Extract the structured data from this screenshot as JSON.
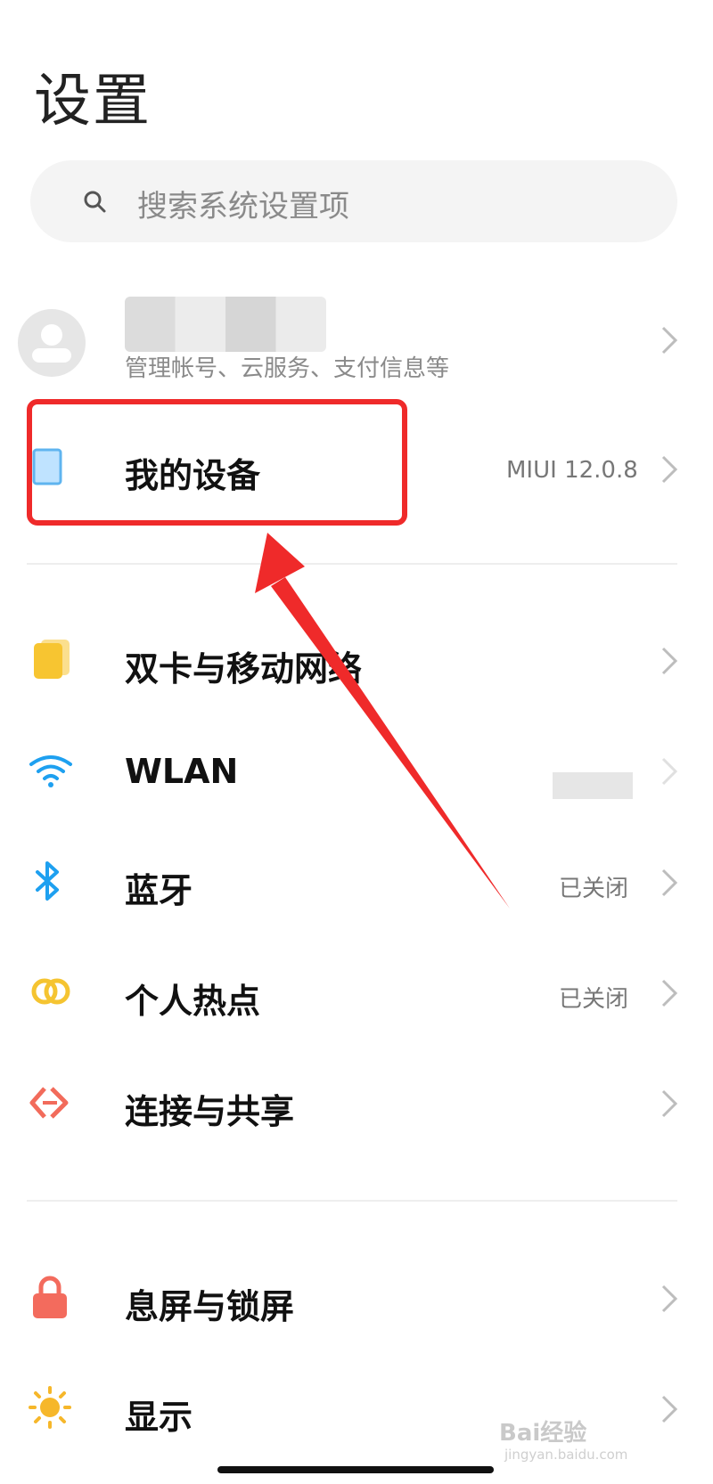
{
  "header": {
    "title": "设置"
  },
  "search": {
    "placeholder": "搜索系统设置项"
  },
  "account": {
    "subtitle": "管理帐号、云服务、支付信息等"
  },
  "items": [
    {
      "id": "my-device",
      "label": "我的设备",
      "value": "MIUI 12.0.8",
      "icon": "device-icon",
      "color": "#bfe3ff"
    },
    {
      "id": "dual-sim",
      "label": "双卡与移动网络",
      "value": "",
      "icon": "sim-card-icon",
      "color": "#f7c531"
    },
    {
      "id": "wlan",
      "label": "WLAN",
      "value": "",
      "icon": "wifi-icon",
      "color": "#1ea0f0"
    },
    {
      "id": "bluetooth",
      "label": "蓝牙",
      "value": "已关闭",
      "icon": "bluetooth-icon",
      "color": "#1ea0f0"
    },
    {
      "id": "hotspot",
      "label": "个人热点",
      "value": "已关闭",
      "icon": "hotspot-icon",
      "color": "#f5c431"
    },
    {
      "id": "connection-sharing",
      "label": "连接与共享",
      "value": "",
      "icon": "share-icon",
      "color": "#f26b5b"
    },
    {
      "id": "lock-screen",
      "label": "息屏与锁屏",
      "value": "",
      "icon": "lock-icon",
      "color": "#f36b5d"
    },
    {
      "id": "display",
      "label": "显示",
      "value": "",
      "icon": "sun-icon",
      "color": "#f6b72a"
    }
  ],
  "watermark": {
    "main": "Bai经验",
    "sub": "jingyan.baidu.com"
  },
  "colors": {
    "highlight": "#ef2a2a",
    "accent": "#1ea0f0"
  }
}
